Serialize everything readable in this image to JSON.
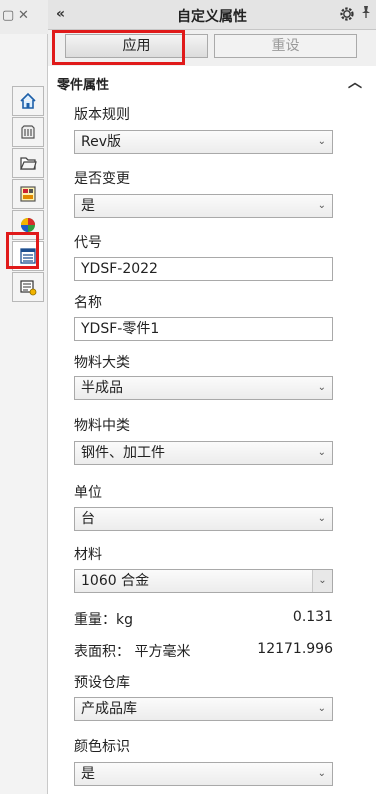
{
  "strip": {
    "restore_glyph": "▢",
    "close_glyph": "✕"
  },
  "panel": {
    "collapse_glyph": "«",
    "title": "自定义属性",
    "pin_glyph": "📌",
    "apply_label": "应用",
    "reset_label": "重设",
    "group_title": "零件属性",
    "group_chevron": "︿"
  },
  "fields": {
    "version_rule": {
      "label": "版本规则",
      "value": "Rev版"
    },
    "is_changed": {
      "label": "是否变更",
      "value": "是"
    },
    "code": {
      "label": "代号",
      "value": "YDSF-2022"
    },
    "name": {
      "label": "名称",
      "value": "YDSF-零件1"
    },
    "category_major": {
      "label": "物料大类",
      "value": "半成品"
    },
    "category_mid": {
      "label": "物料中类",
      "value": "钢件、加工件"
    },
    "unit": {
      "label": "单位",
      "value": "台"
    },
    "material": {
      "label": "材料",
      "value": "1060 合金"
    },
    "weight": {
      "label": "重量：kg",
      "value": "0.131"
    },
    "area": {
      "label": "表面积： 平方毫米",
      "value": "12171.996"
    },
    "warehouse": {
      "label": "预设仓库",
      "value": "产成品库"
    },
    "color_mark": {
      "label": "颜色标识",
      "value": "是"
    }
  },
  "dropdown_arrow": "⌄",
  "colors": {
    "highlight": "#e01a1a",
    "titlebar": "#e4e4e4"
  },
  "icons": [
    "home-icon",
    "parts-icon",
    "folder-icon",
    "view-palette-icon",
    "appearance-icon",
    "custom-properties-icon",
    "properties-icon"
  ]
}
